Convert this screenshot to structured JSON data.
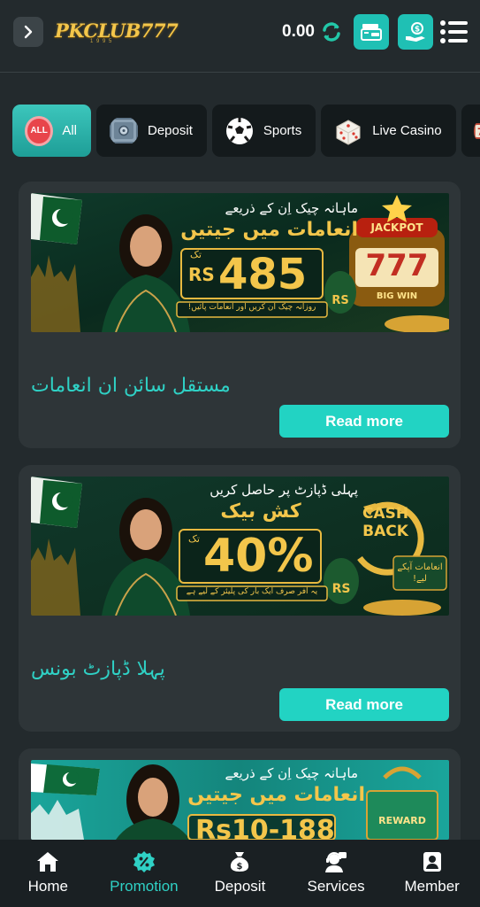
{
  "header": {
    "logo": "PKCLUB777",
    "logo_sub": "1 9 9 5",
    "balance": "0.00"
  },
  "categories": [
    {
      "label": "All",
      "icon": "all-badge-icon",
      "badge": "ALL"
    },
    {
      "label": "Deposit",
      "icon": "safe-icon"
    },
    {
      "label": "Sports",
      "icon": "soccer-ball-icon"
    },
    {
      "label": "Live Casino",
      "icon": "dice-icon"
    },
    {
      "label": "",
      "icon": "slot-777-icon"
    }
  ],
  "promos": [
    {
      "title": "مستقل سائن ان انعامات",
      "read_more": "Read more",
      "banner": {
        "line1": "ماہانہ چیک اِن کے ذریعے",
        "line2": "انعامات میں جیتیں",
        "tag": "تک",
        "amount": "485",
        "currency": "RS",
        "footer": "روزانہ چیک ان کریں اور انعامات پائیں!",
        "jackpot": "JACKPOT",
        "reels": "777",
        "bigwin": "BIG WIN"
      }
    },
    {
      "title": "پہلا ڈپازٹ بونس",
      "read_more": "Read more",
      "banner": {
        "line1": "پہلی ڈپازٹ پر حاصل کریں",
        "line2": "کش بیک",
        "tag": "تک",
        "amount": "40%",
        "footer": "یہ آفر صرف ایک بار کی پلیئر کے لیے ہے",
        "cashback": "CASH BACK",
        "side": "انعامات آپکے لیے!"
      }
    },
    {
      "title": "",
      "read_more": "",
      "banner": {
        "line1": "ماہانہ چیک اِن کے ذریعے",
        "line2": "انعامات میں جیتیں",
        "amount": "Rs10-188",
        "reward": "REWARD"
      }
    }
  ],
  "bottom_nav": [
    {
      "label": "Home",
      "icon": "home-icon"
    },
    {
      "label": "Promotion",
      "icon": "percent-badge-icon",
      "active": true
    },
    {
      "label": "Deposit",
      "icon": "money-bag-icon"
    },
    {
      "label": "Services",
      "icon": "support-agent-icon"
    },
    {
      "label": "Member",
      "icon": "member-card-icon"
    }
  ],
  "colors": {
    "accent": "#22d3c3",
    "background": "#232a2d",
    "card": "#2e3538",
    "gold": "#f3c64b"
  }
}
